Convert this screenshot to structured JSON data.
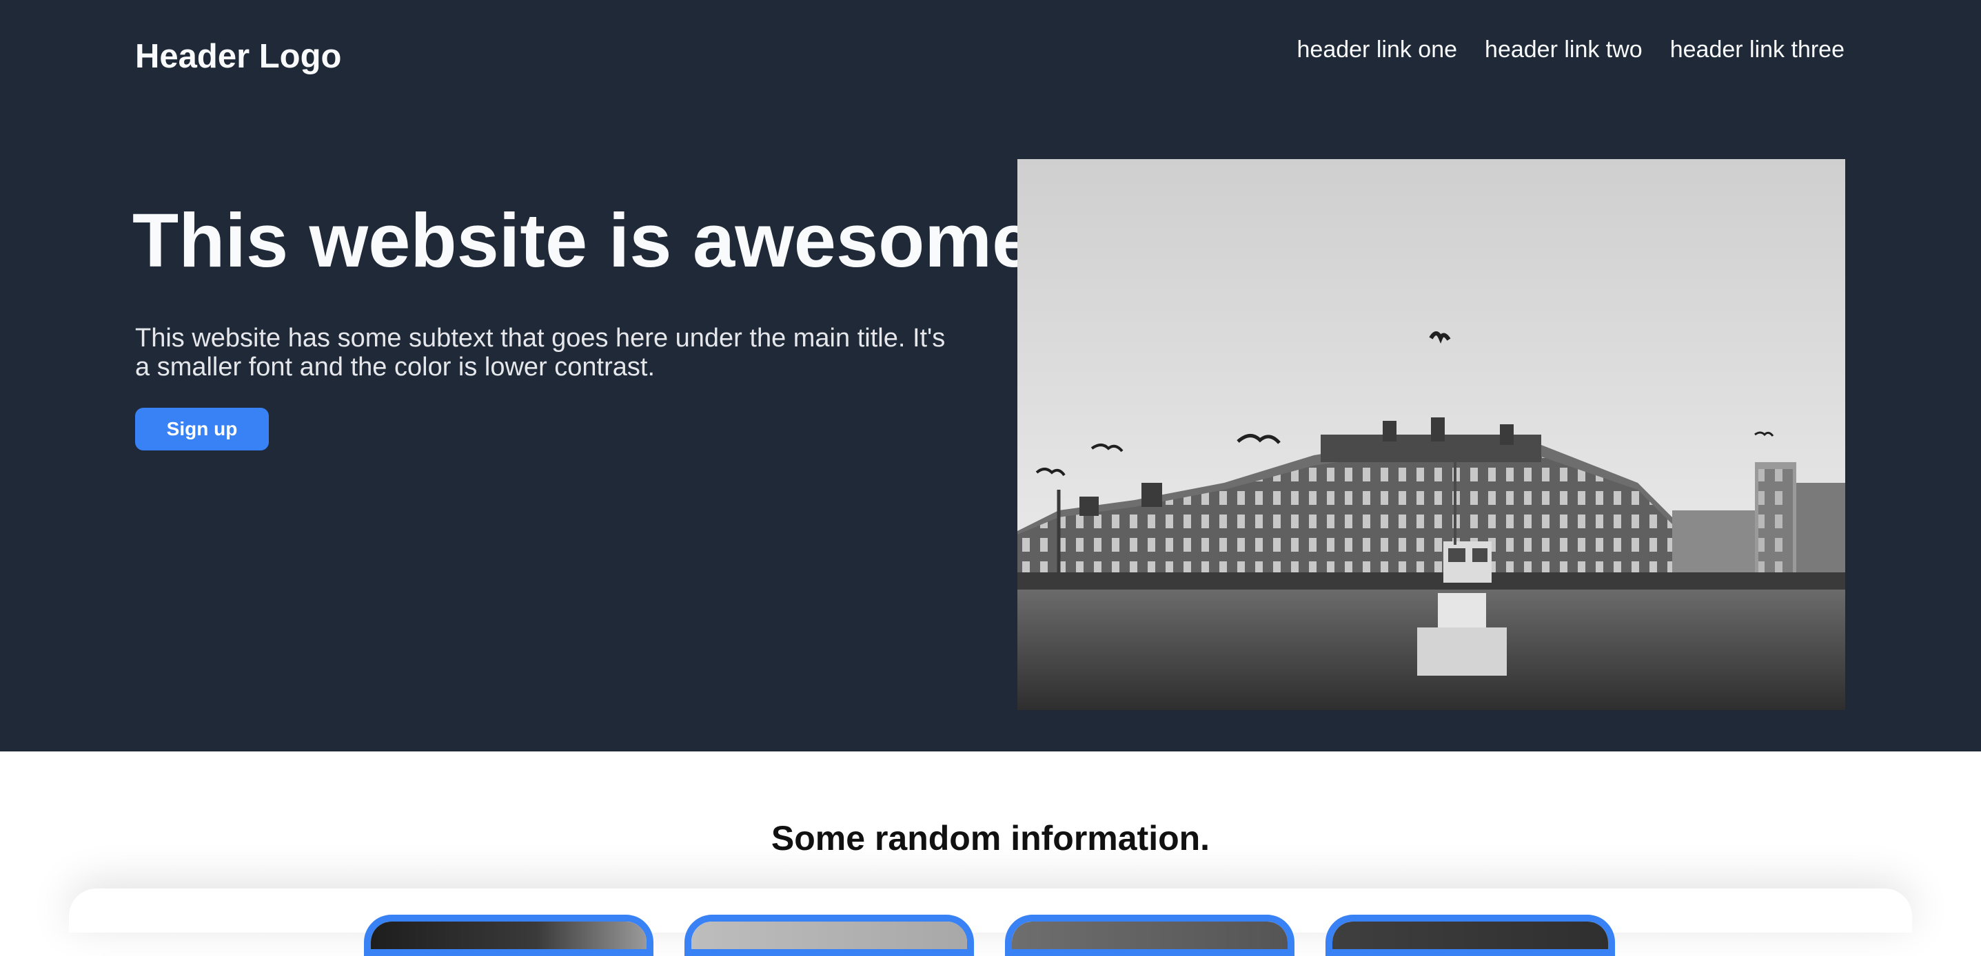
{
  "header": {
    "logo": "Header Logo",
    "nav": [
      "header link one",
      "header link two",
      "header link three"
    ]
  },
  "hero": {
    "title": "This website is awesome",
    "subtext": "This website has some subtext that goes here under the main title. It's a smaller font and the color is lower contrast.",
    "cta_label": "Sign up",
    "image": "black-and-white beach photo with seagulls and a large building"
  },
  "info": {
    "title": "Some random information.",
    "cards": [
      {
        "image": "photo-thumbnail"
      },
      {
        "image": "photo-thumbnail"
      },
      {
        "image": "photo-thumbnail"
      },
      {
        "image": "photo-thumbnail"
      }
    ]
  },
  "colors": {
    "hero_bg": "#1f2937",
    "accent": "#3882f6",
    "page_bg": "#ffffff"
  }
}
